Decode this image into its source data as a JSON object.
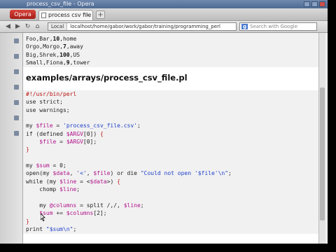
{
  "window": {
    "title": "process_csv_file - Opera"
  },
  "tabbar": {
    "menu_label": "Opera",
    "active_tab": "process csv file",
    "new_tab_label": "+"
  },
  "addressbar": {
    "badge": "Local",
    "url": "localhost/home/gabor/work/gabor/training/programming_perl",
    "search_placeholder": "Search with Google",
    "search_engine_icon": "g"
  },
  "icons": {
    "back": "back-arrow-icon",
    "forward": "forward-arrow-icon",
    "reload": "reload-icon",
    "home": "home-icon"
  },
  "csv_lines": [
    [
      "Foo,Bar,",
      "10",
      ",home"
    ],
    [
      "Orgo,Morgo,",
      "7",
      ",away"
    ],
    [
      "Big,Shrek,",
      "100",
      ",US"
    ],
    [
      "Small,Fiona,",
      "9",
      ",tower"
    ]
  ],
  "heading": "examples/arrays/process_csv_file.pl",
  "code_lines": [
    "#!/usr/bin/perl",
    "use strict;",
    "use warnings;",
    "",
    "my $file = 'process_csv_file.csv';",
    "if (defined $ARGV[0]) {",
    "    $file = $ARGV[0];",
    "}",
    "",
    "my $sum = 0;",
    "open(my $data, '<', $file) or die \"Could not open '$file'\\n\";",
    "while (my $line = <$data>) {",
    "    chomp $line;",
    "",
    "    my @columns = split /,/, $line;",
    "    $sum += $columns[2];",
    "}",
    "print \"$sum\\n\";"
  ],
  "colors": {
    "comment": "#bb1111",
    "variable": "#b0108a",
    "string": "#1f41c9",
    "brace": "#c01818"
  }
}
